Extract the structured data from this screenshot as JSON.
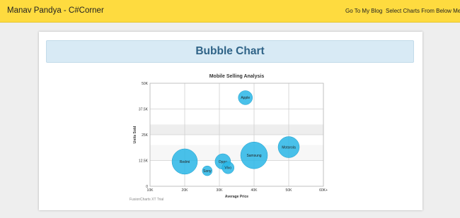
{
  "navbar": {
    "brand": "Manav Pandya - C#Corner",
    "links": [
      "Go To My Blog",
      "Select Charts From Below Menu"
    ]
  },
  "page": {
    "heading": "Bubble Chart",
    "trial_text": "FusionCharts XT Trial"
  },
  "colors": {
    "navbar_bg": "#fedb3f",
    "heading": "#2f6387",
    "bubble": "#29b6e6"
  },
  "chart_data": {
    "type": "scatter",
    "subtype": "bubble",
    "title": "Mobile Selling Analysis",
    "xlabel": "Average Price",
    "ylabel": "Units Sold",
    "xlim": [
      10000,
      60000
    ],
    "ylim": [
      0,
      50000
    ],
    "x_ticks": [
      "10K",
      "20K",
      "30K",
      "40K",
      "50K",
      "60K+"
    ],
    "y_ticks": [
      "0",
      "12.5K",
      "25K",
      "37.5K",
      "50K"
    ],
    "grid": true,
    "bands": [
      [
        12500,
        20000
      ],
      [
        20000,
        25000
      ],
      [
        25000,
        30000
      ]
    ],
    "series": [
      {
        "points": [
          {
            "label": "Apple",
            "x": 37500,
            "y": 43000,
            "z": 20
          },
          {
            "label": "Redmi",
            "x": 20000,
            "y": 12000,
            "z": 36
          },
          {
            "label": "Sony",
            "x": 26500,
            "y": 7500,
            "z": 14
          },
          {
            "label": "Oppo",
            "x": 31000,
            "y": 12000,
            "z": 22
          },
          {
            "label": "Vivo",
            "x": 32500,
            "y": 9000,
            "z": 17
          },
          {
            "label": "Samsung",
            "x": 40000,
            "y": 15000,
            "z": 38
          },
          {
            "label": "Motorola",
            "x": 50000,
            "y": 19000,
            "z": 30
          }
        ]
      }
    ]
  }
}
